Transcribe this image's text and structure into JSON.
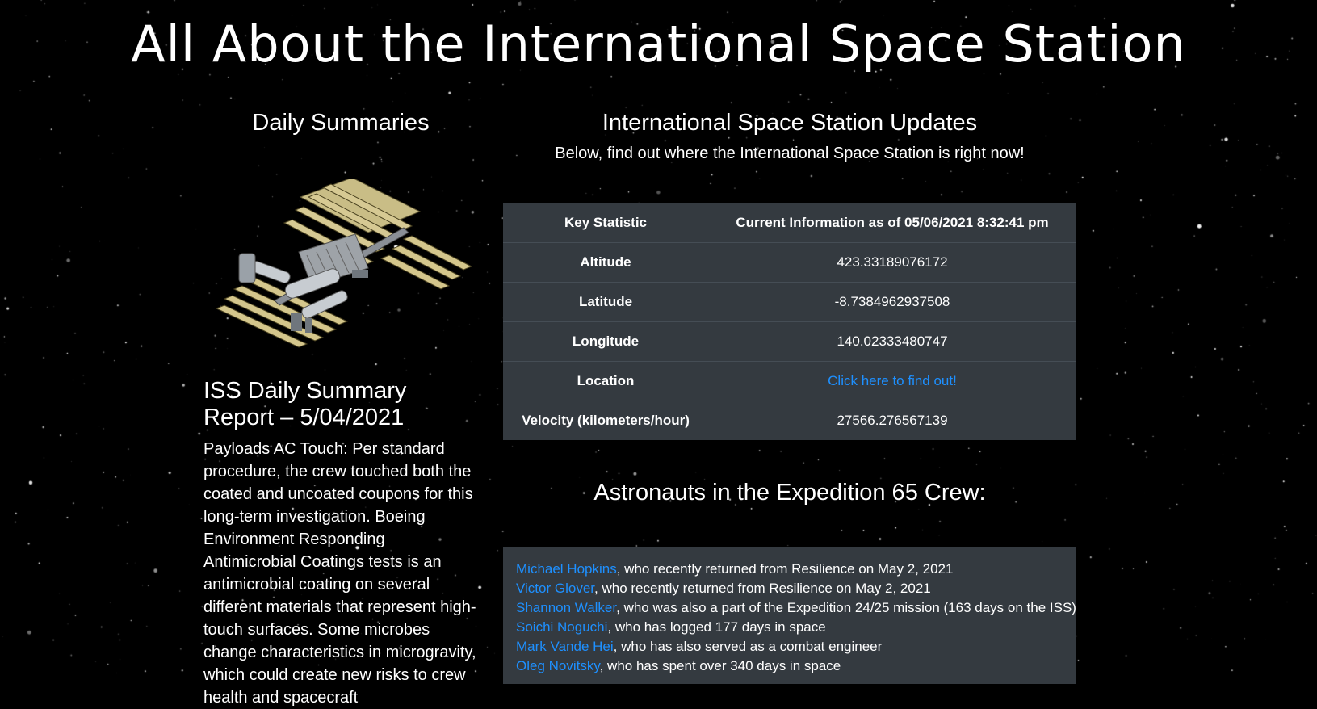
{
  "page": {
    "title": "All About the International Space Station"
  },
  "daily": {
    "heading": "Daily Summaries",
    "image_alt": "International Space Station",
    "report_title": "ISS Daily Summary Report – 5/04/2021",
    "report_body": "Payloads AC Touch: Per standard procedure, the crew touched both the coated and uncoated coupons for this long-term investigation. Boeing Environment Responding Antimicrobial Coatings tests is an antimicrobial coating on several different materials that represent high-touch surfaces. Some microbes change characteristics in microgravity, which could create new risks to crew health and spacecraft"
  },
  "updates": {
    "heading": "International Space Station Updates",
    "subheading": "Below, find out where the International Space Station is right now!",
    "table": {
      "header_key": "Key Statistic",
      "header_value": "Current Information as of 05/06/2021 8:32:41 pm",
      "rows": [
        {
          "key": "Altitude",
          "value": "423.33189076172"
        },
        {
          "key": "Latitude",
          "value": "-8.7384962937508"
        },
        {
          "key": "Longitude",
          "value": "140.02333480747"
        },
        {
          "key": "Location",
          "value": "Click here to find out!"
        },
        {
          "key": "Velocity (kilometers/hour)",
          "value": "27566.276567139"
        }
      ]
    }
  },
  "crew": {
    "heading": "Astronauts in the Expedition 65 Crew:",
    "members": [
      {
        "name": "Michael Hopkins",
        "note": ", who recently returned from Resilience on May 2, 2021"
      },
      {
        "name": "Victor Glover",
        "note": ", who recently returned from Resilience on May 2, 2021"
      },
      {
        "name": "Shannon Walker",
        "note": ", who was also a part of the Expedition 24/25 mission (163 days on the ISS)"
      },
      {
        "name": "Soichi Noguchi",
        "note": ", who has logged 177 days in space"
      },
      {
        "name": "Mark Vande Hei",
        "note": ", who has also served as a combat engineer"
      },
      {
        "name": "Oleg Novitsky",
        "note": ", who has spent over 340 days in space"
      }
    ]
  },
  "colors": {
    "background": "#000000",
    "panel": "#343a40",
    "link": "#1e90ff",
    "text": "#ffffff"
  }
}
